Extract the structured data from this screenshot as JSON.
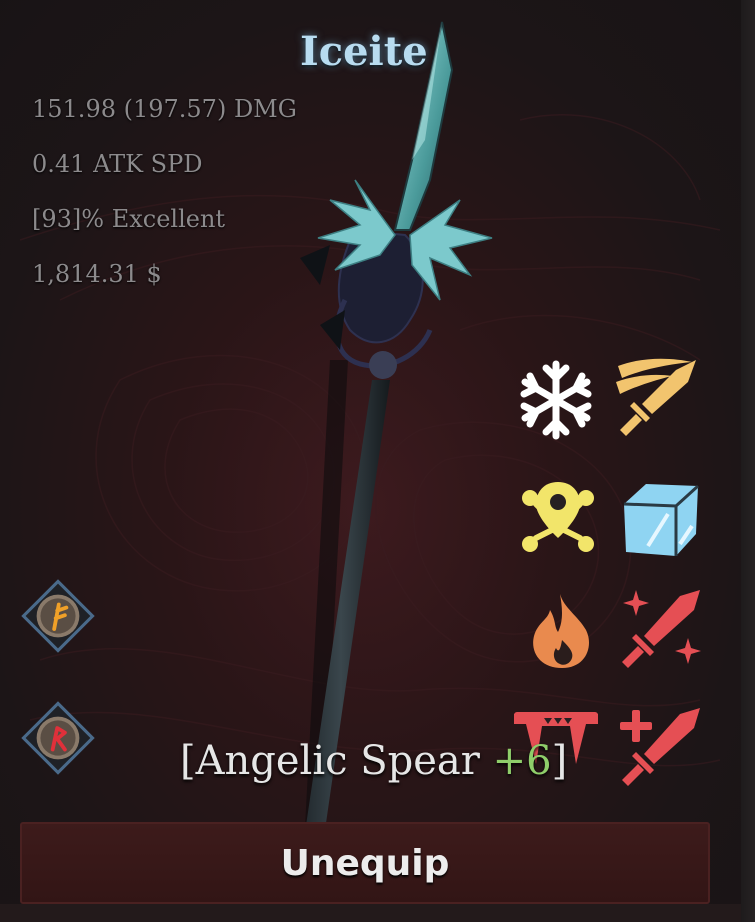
{
  "weapon": {
    "name": "Iceite",
    "damage": "151.98 (197.57) DMG",
    "attack_speed": "0.41 ATK SPD",
    "quality": "[93]% Excellent",
    "value": "1,814.31 $",
    "item_name_prefix": "[Angelic Spear ",
    "item_name_bonus": "+6",
    "item_name_suffix": "]"
  },
  "perks": [
    {
      "icon": "snowflake-icon",
      "color": "#ffffff"
    },
    {
      "icon": "slash-sword-icon",
      "color": "#f2c46e"
    },
    {
      "icon": "skull-pin-icon",
      "color": "#f2e56a"
    },
    {
      "icon": "ice-cube-icon",
      "color": "#8fd4f2"
    },
    {
      "icon": "fire-icon",
      "color": "#e98a4e"
    },
    {
      "icon": "sparkle-sword-icon",
      "color": "#e54f54"
    },
    {
      "icon": "fangs-icon",
      "color": "#e54f54"
    },
    {
      "icon": "plus-sword-icon",
      "color": "#e54f54"
    }
  ],
  "runes": [
    {
      "icon": "rune-f-icon",
      "color": "#f0a028"
    },
    {
      "icon": "rune-r-icon",
      "color": "#e0303a"
    }
  ],
  "actions": {
    "unequip_label": "Unequip"
  }
}
